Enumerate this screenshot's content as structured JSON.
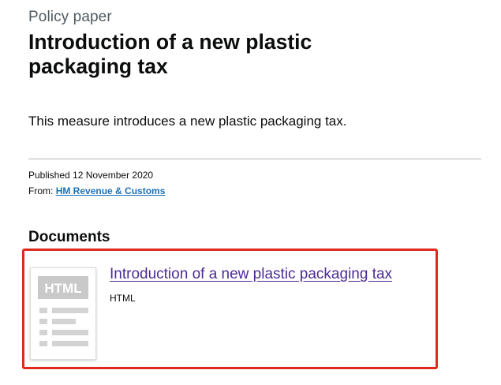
{
  "header": {
    "caption": "Policy paper",
    "title": "Introduction of a new plastic packaging tax"
  },
  "summary": "This measure introduces a new plastic packaging tax.",
  "metadata": {
    "published_text": "Published 12 November 2020",
    "from_label": "From:",
    "from_link": "HM Revenue & Customs"
  },
  "documents": {
    "heading": "Documents",
    "items": [
      {
        "thumbnail_label": "HTML",
        "thumbnail_icon": "html-document-icon",
        "title": "Introduction of a new plastic packaging tax",
        "type": "HTML"
      }
    ]
  },
  "colors": {
    "link": "#1d70b8",
    "visited_link": "#4c2c92",
    "highlight": "#e02a1f",
    "text": "#0b0c0c",
    "secondary_text": "#505a5f"
  }
}
